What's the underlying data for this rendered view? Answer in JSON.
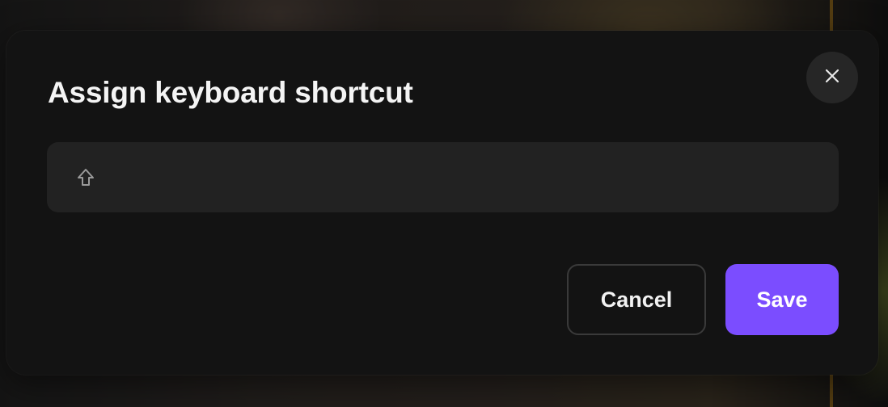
{
  "dialog": {
    "title": "Assign keyboard shortcut",
    "close_icon": "close-icon",
    "shortcut_field": {
      "keys": [
        "shift"
      ],
      "key_icon": "shift-key-icon"
    },
    "cancel_label": "Cancel",
    "save_label": "Save"
  },
  "colors": {
    "dialog_background": "#131313",
    "field_background": "#222222",
    "save_button": "#7b4dff",
    "close_button": "#262626"
  }
}
